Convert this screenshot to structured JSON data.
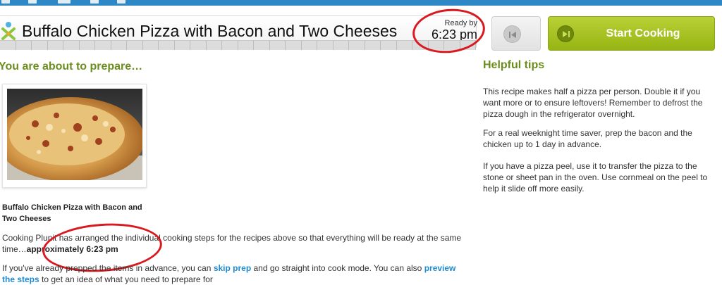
{
  "header": {
    "title": "Buffalo Chicken Pizza with Bacon and Two Cheeses",
    "ready_by_label": "Ready by",
    "ready_time": "6:23 pm"
  },
  "buttons": {
    "start_cooking": "Start Cooking"
  },
  "left": {
    "heading": "You are about to prepare…",
    "recipe_name": "Buffalo Chicken Pizza with Bacon and Two Cheeses",
    "para1_text": "Cooking Plunit has arranged the individual cooking steps for the recipes above so that everything will be ready at the same time…",
    "para1_bold": "approximately 6:23 pm",
    "para2_a": "If you've already prepped the items in advance, you can ",
    "link_skip_prep": "skip prep",
    "para2_b": " and go straight into cook mode. You can also ",
    "link_preview": "preview the steps",
    "para2_c": " to get an idea of what you need to prepare for"
  },
  "tips": {
    "heading": "Helpful tips",
    "items": [
      "This recipe makes half a pizza per person. Double it if you want more or to ensure leftovers! Remember to defrost the pizza dough in the refrigerator overnight.",
      "For a real weeknight time saver, prep the bacon and the chicken up to 1 day in advance.",
      "If you have a pizza peel, use it to transfer the pizza to the stone or sheet pan in the oven. Use cornmeal on the peel to help it slide off more easily."
    ]
  },
  "colors": {
    "accent_green": "#6b8e1c",
    "start_button": "#a6c21f",
    "link_blue": "#1f8bd1",
    "annotation_red": "#d9191f",
    "top_bar_blue": "#2e88c6"
  },
  "icons": {
    "logo": "chef-logo-icon",
    "back": "skip-back-icon",
    "start": "skip-forward-icon"
  },
  "progress": {
    "segments": 30
  }
}
